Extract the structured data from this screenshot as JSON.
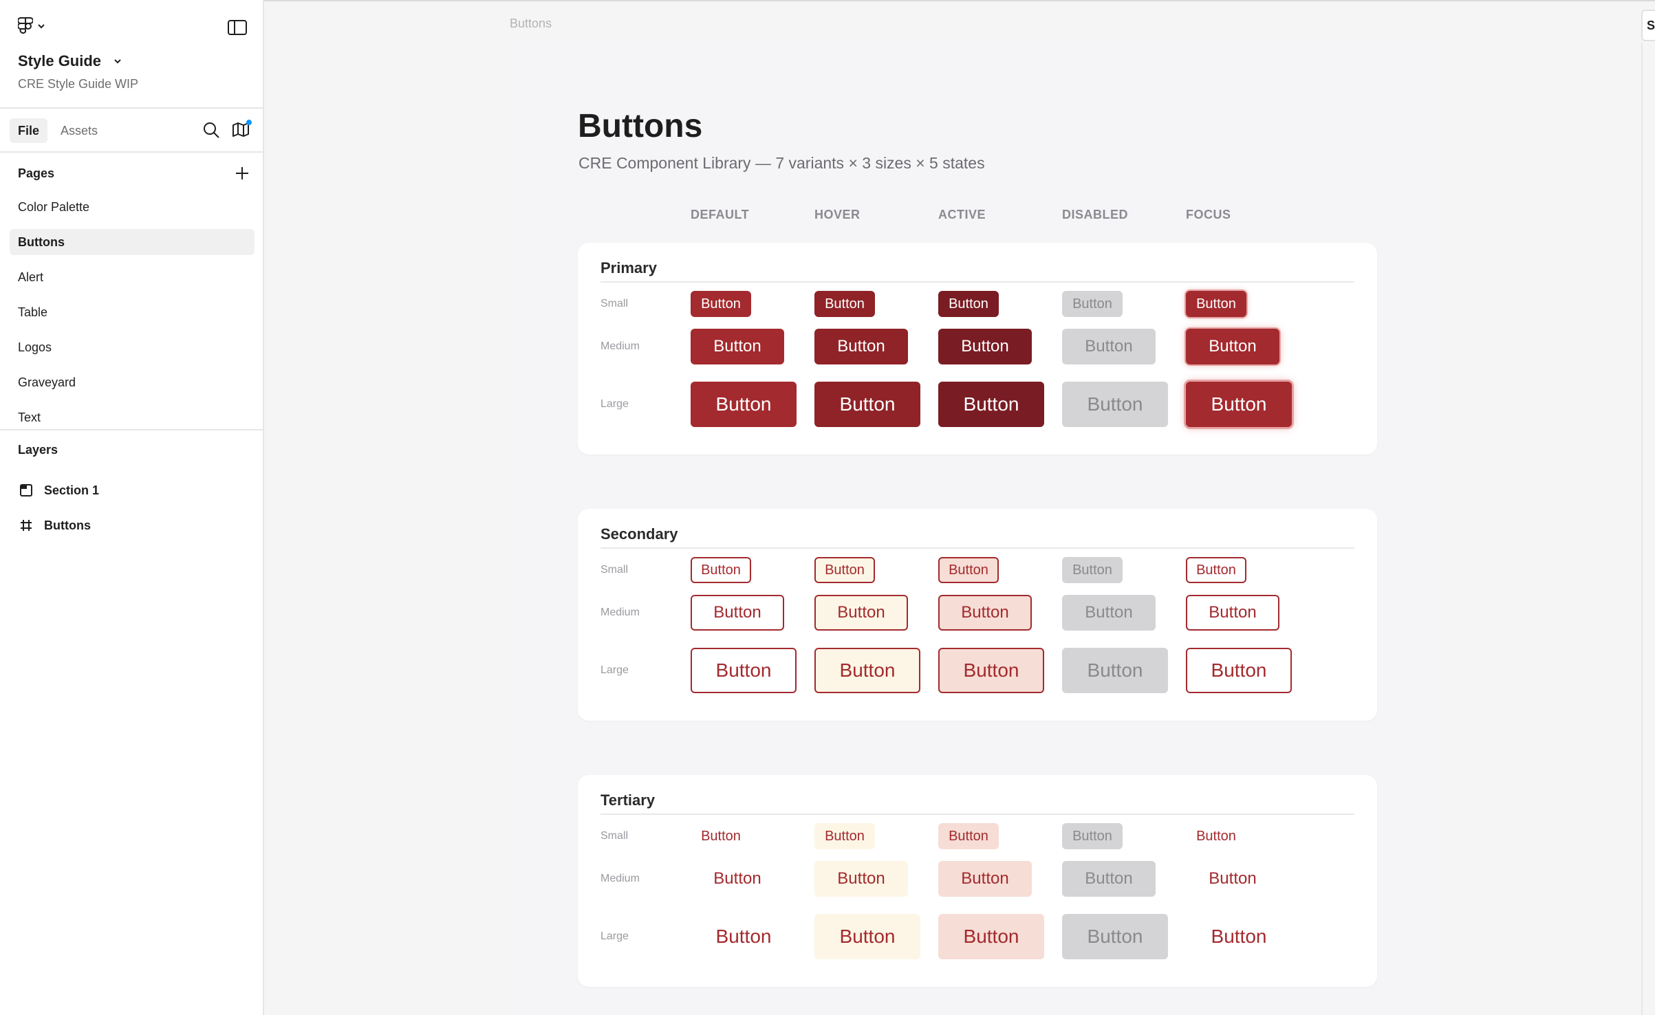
{
  "sidebar": {
    "file_title": "Style Guide",
    "file_subtitle": "CRE Style Guide WIP",
    "tabs": [
      {
        "label": "File",
        "active": true
      },
      {
        "label": "Assets",
        "active": false
      }
    ],
    "pages_header": "Pages",
    "pages": [
      {
        "label": "Color Palette",
        "active": false
      },
      {
        "label": "Buttons",
        "active": true
      },
      {
        "label": "Alert",
        "active": false
      },
      {
        "label": "Table",
        "active": false
      },
      {
        "label": "Logos",
        "active": false
      },
      {
        "label": "Graveyard",
        "active": false
      },
      {
        "label": "Text",
        "active": false
      }
    ],
    "layers_header": "Layers",
    "layers": [
      {
        "label": "Section 1",
        "icon": "section-icon"
      },
      {
        "label": "Buttons",
        "icon": "frame-hash-icon"
      }
    ]
  },
  "canvas": {
    "frame_label": "Buttons",
    "title": "Buttons",
    "subtitle": "CRE Component Library — 7 variants × 3 sizes × 5 states",
    "states": [
      "DEFAULT",
      "HOVER",
      "ACTIVE",
      "DISABLED",
      "FOCUS"
    ],
    "sizes": [
      "Small",
      "Medium",
      "Large"
    ],
    "button_label": "Button",
    "variants": [
      "Primary",
      "Secondary",
      "Tertiary"
    ]
  },
  "right_edge_letter": "S",
  "colors": {
    "brand_red": "#a32a2e",
    "brand_red_hover": "#8f2328",
    "brand_red_active": "#7a1c24",
    "disabled_bg": "#d4d4d6",
    "disabled_text": "#8a8a8e",
    "hover_cream": "#fdf6e6",
    "active_pink": "#f6ddd5"
  }
}
